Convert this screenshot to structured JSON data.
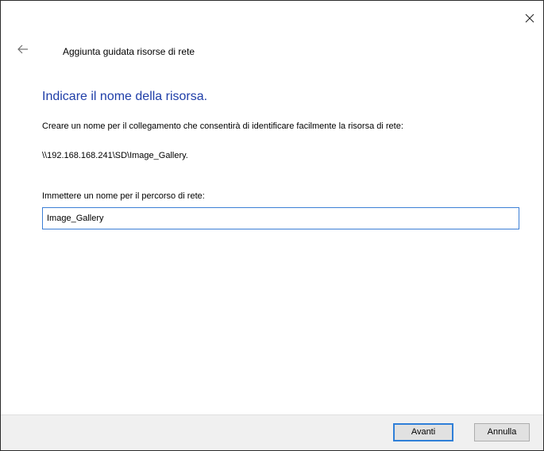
{
  "window": {
    "close_icon": "close-icon"
  },
  "header": {
    "back_icon": "back-arrow-icon",
    "title": "Aggiunta guidata risorse di rete"
  },
  "main": {
    "heading": "Indicare il nome della risorsa.",
    "description": "Creare un nome per il collegamento che consentirà di identificare facilmente la risorsa di rete:",
    "network_path": "\\\\192.168.168.241\\SD\\Image_Gallery.",
    "name_label": "Immettere un nome per il percorso di rete:",
    "name_value": "Image_Gallery"
  },
  "footer": {
    "next_label": "Avanti",
    "cancel_label": "Annulla"
  },
  "colors": {
    "heading": "#1f3ea8",
    "focus_border": "#3c7fd6",
    "footer_bg": "#f0f0f0"
  }
}
